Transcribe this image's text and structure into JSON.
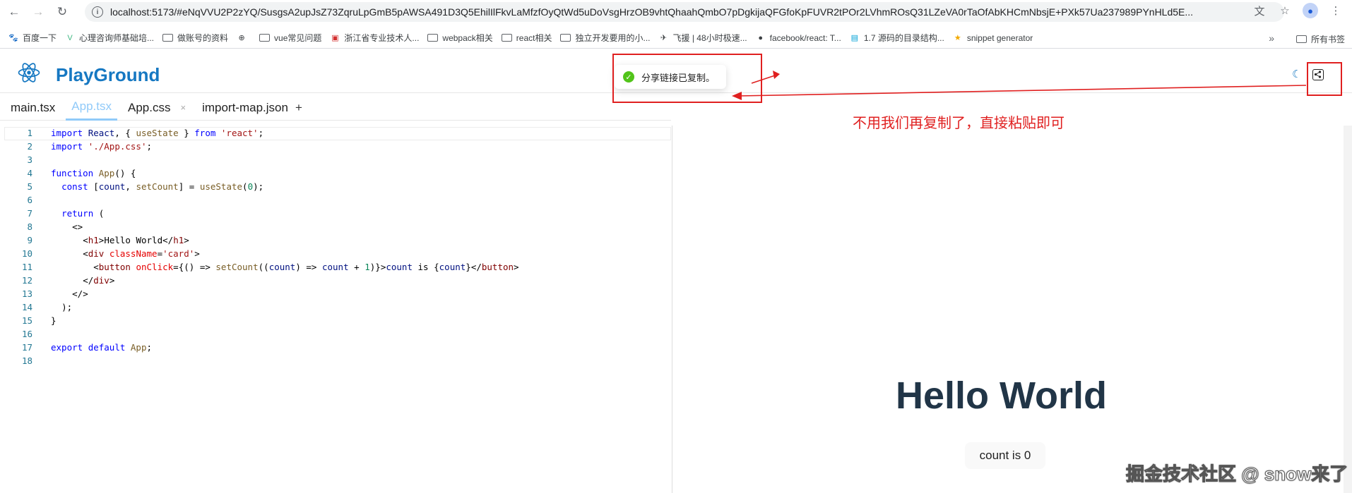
{
  "browser": {
    "url": "localhost:5173/#eNqVVU2P2zYQ/SusgsA2upJsZ73ZqruLpGmB5pAWSA491D3Q5EhilIlFkvLaMfzfOyQtWd5uDoVsgHrzOB9vhtQhaahQmbO7pDgkijaQFGfoKpFUVR2tPOr2LVhmROsQ31LZeVA0rTaOfAbKHCmNbsjE+PXk57Ua237989PYnHLd5E...",
    "actions": [
      "translate-icon",
      "star-icon",
      "profile-icon",
      "menu-icon"
    ]
  },
  "bookmarks": [
    {
      "icon": "paw-icon",
      "label": "百度一下"
    },
    {
      "icon": "vue-icon",
      "label": "心理咨询师基础培..."
    },
    {
      "icon": "folder-icon",
      "label": "做账号的资料"
    },
    {
      "icon": "globe-icon",
      "label": ""
    },
    {
      "icon": "folder-icon",
      "label": "vue常见问题"
    },
    {
      "icon": "site-icon",
      "label": "浙江省专业技术人..."
    },
    {
      "icon": "folder-icon",
      "label": "webpack相关"
    },
    {
      "icon": "folder-icon",
      "label": "react相关"
    },
    {
      "icon": "folder-icon",
      "label": "独立开发要用的小..."
    },
    {
      "icon": "feishu-icon",
      "label": "飞援 | 48小时极速..."
    },
    {
      "icon": "github-icon",
      "label": "facebook/react: T..."
    },
    {
      "icon": "bilibili-icon",
      "label": "1.7 源码的目录结构..."
    },
    {
      "icon": "star-icon",
      "label": "snippet generator"
    }
  ],
  "bookmarks_all": "所有书签",
  "app": {
    "brand": "PlayGround",
    "toast": "分享链接已复制。"
  },
  "tabs": [
    {
      "label": "main.tsx",
      "active": false
    },
    {
      "label": "App.tsx",
      "active": true
    },
    {
      "label": "App.css",
      "active": false,
      "closable": true
    },
    {
      "label": "import-map.json",
      "active": false
    }
  ],
  "tab_add": "+",
  "code": [
    "import React, { useState } from 'react';",
    "import './App.css';",
    "",
    "function App() {",
    "  const [count, setCount] = useState(0);",
    "",
    "  return (",
    "    <>",
    "      <h1>Hello World</h1>",
    "      <div className='card'>",
    "        <button onClick={() => setCount((count) => count + 1)}>count is {count}</button>",
    "      </div>",
    "    </>",
    "  );",
    "}",
    "",
    "export default App;",
    ""
  ],
  "preview": {
    "heading": "Hello World",
    "button": "count is 0"
  },
  "annotation": "不用我们再复制了，直接粘贴即可",
  "watermark": "掘金技术社区 @ snow来了",
  "colors": {
    "brand": "#1678c2",
    "annotation": "#e02020",
    "active_tab": "#90caf9"
  }
}
